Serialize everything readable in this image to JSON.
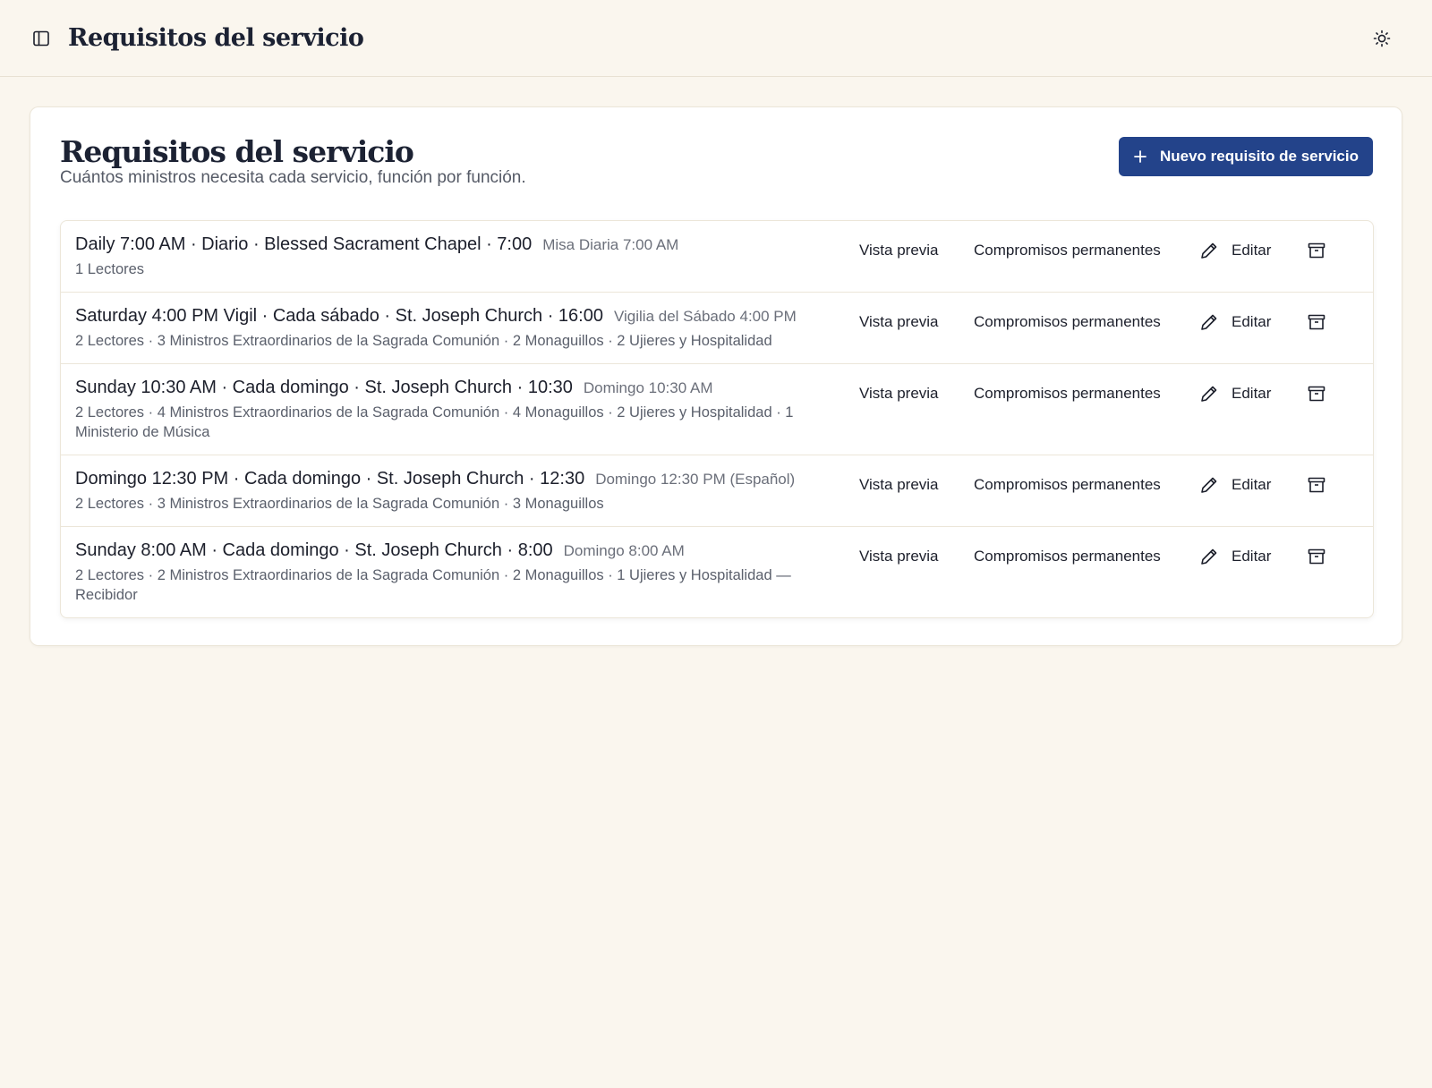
{
  "header": {
    "title": "Requisitos del servicio",
    "sidebar_icon": "sidebar-panel-icon",
    "theme_icon": "sun-icon"
  },
  "card": {
    "title": "Requisitos del servicio",
    "subtitle": "Cuántos ministros necesita cada servicio, función por función.",
    "new_button_label": "Nuevo requisito de servicio"
  },
  "actions": {
    "preview": "Vista previa",
    "commitments": "Compromisos permanentes",
    "edit": "Editar"
  },
  "rows": [
    {
      "title": "Daily 7:00 AM · Diario · Blessed Sacrament Chapel · 7:00",
      "label": "Misa Diaria 7:00 AM",
      "roles": "1 Lectores"
    },
    {
      "title": "Saturday 4:00 PM Vigil · Cada sábado · St. Joseph Church · 16:00",
      "label": "Vigilia del Sábado 4:00 PM",
      "roles": "2 Lectores · 3 Ministros Extraordinarios de la Sagrada Comunión · 2 Monaguillos · 2 Ujieres y Hospitalidad"
    },
    {
      "title": "Sunday 10:30 AM · Cada domingo · St. Joseph Church · 10:30",
      "label": "Domingo 10:30 AM",
      "roles": "2 Lectores · 4 Ministros Extraordinarios de la Sagrada Comunión · 4 Monaguillos · 2 Ujieres y Hospitalidad · 1 Ministerio de Música"
    },
    {
      "title": "Domingo 12:30 PM · Cada domingo · St. Joseph Church · 12:30",
      "label": "Domingo 12:30 PM (Español)",
      "roles": "2 Lectores · 3 Ministros Extraordinarios de la Sagrada Comunión · 3 Monaguillos"
    },
    {
      "title": "Sunday 8:00 AM · Cada domingo · St. Joseph Church · 8:00",
      "label": "Domingo 8:00 AM",
      "roles": "2 Lectores · 2 Ministros Extraordinarios de la Sagrada Comunión · 2 Monaguillos · 1 Ujieres y Hospitalidad — Recibidor"
    }
  ],
  "colors": {
    "background": "#faf6ee",
    "primary": "#23438a",
    "text": "#1c1f2b",
    "muted": "#5b606c"
  }
}
